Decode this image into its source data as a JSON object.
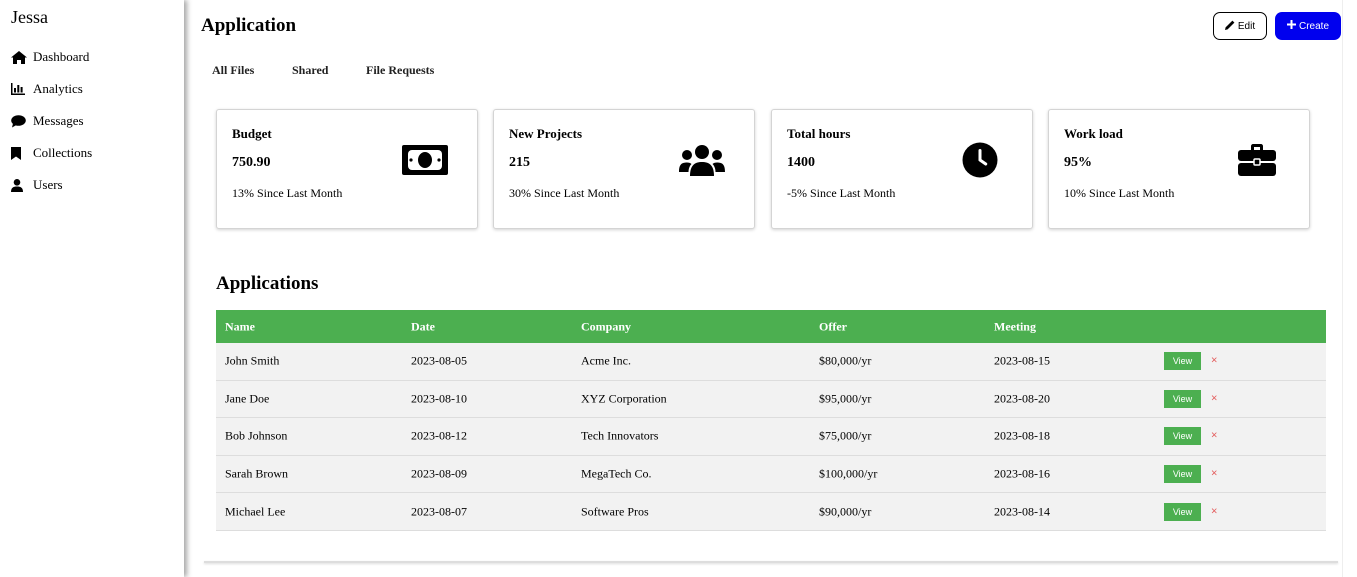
{
  "sidebar": {
    "brand": "Jessa",
    "items": [
      {
        "label": "Dashboard",
        "icon": "home-icon"
      },
      {
        "label": "Analytics",
        "icon": "bar-chart-icon"
      },
      {
        "label": "Messages",
        "icon": "chat-bubble-icon"
      },
      {
        "label": "Collections",
        "icon": "bookmark-icon"
      },
      {
        "label": "Users",
        "icon": "user-icon"
      }
    ]
  },
  "header": {
    "title": "Application",
    "edit_label": "Edit",
    "create_label": "Create"
  },
  "tabs": [
    {
      "label": "All Files"
    },
    {
      "label": "Shared"
    },
    {
      "label": "File Requests"
    }
  ],
  "cards": [
    {
      "title": "Budget",
      "value": "750.90",
      "note": "13% Since Last Month",
      "icon": "money-bill-icon"
    },
    {
      "title": "New Projects",
      "value": "215",
      "note": "30% Since Last Month",
      "icon": "users-group-icon"
    },
    {
      "title": "Total hours",
      "value": "1400",
      "note": "-5% Since Last Month",
      "icon": "clock-icon"
    },
    {
      "title": "Work load",
      "value": "95%",
      "note": "10% Since Last Month",
      "icon": "briefcase-icon"
    }
  ],
  "applications": {
    "title": "Applications",
    "columns": [
      "Name",
      "Date",
      "Company",
      "Offer",
      "Meeting"
    ],
    "rows": [
      {
        "name": "John Smith",
        "date": "2023-08-05",
        "company": "Acme Inc.",
        "offer": "$80,000/yr",
        "meeting": "2023-08-15"
      },
      {
        "name": "Jane Doe",
        "date": "2023-08-10",
        "company": "XYZ Corporation",
        "offer": "$95,000/yr",
        "meeting": "2023-08-20"
      },
      {
        "name": "Bob Johnson",
        "date": "2023-08-12",
        "company": "Tech Innovators",
        "offer": "$75,000/yr",
        "meeting": "2023-08-18"
      },
      {
        "name": "Sarah Brown",
        "date": "2023-08-09",
        "company": "MegaTech Co.",
        "offer": "$100,000/yr",
        "meeting": "2023-08-16"
      },
      {
        "name": "Michael Lee",
        "date": "2023-08-07",
        "company": "Software Pros",
        "offer": "$90,000/yr",
        "meeting": "2023-08-14"
      }
    ],
    "view_label": "View",
    "delete_label": "×"
  },
  "colors": {
    "accent_green": "#4caf50",
    "create_blue": "#0000ee",
    "delete_red": "#e35b5b"
  }
}
